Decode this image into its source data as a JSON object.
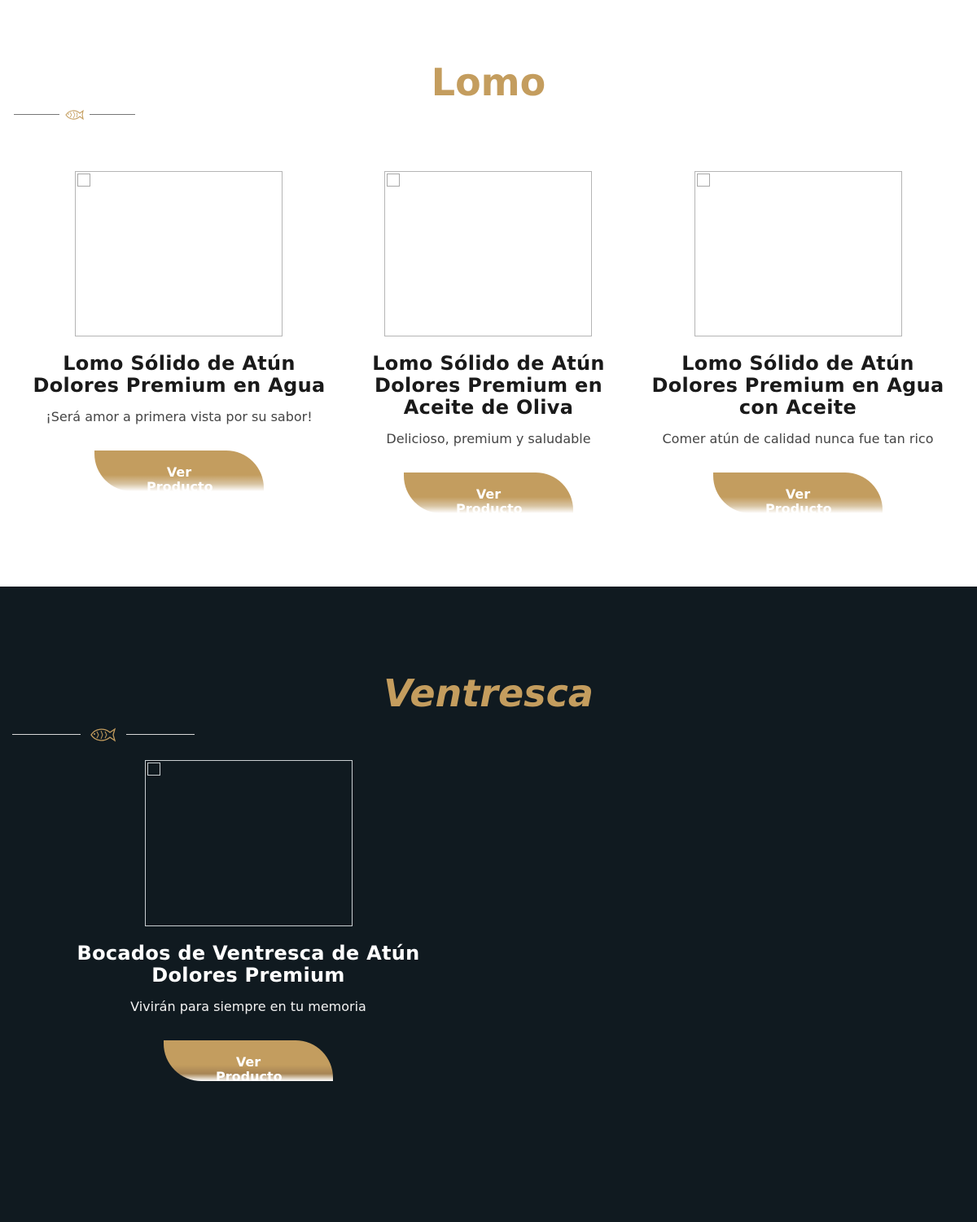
{
  "colors": {
    "accent_gold": "#c49d5e",
    "dark_background": "#101a20",
    "light_background": "#ffffff"
  },
  "lomo": {
    "title": "Lomo",
    "divider_icon": "fish-icon",
    "products": [
      {
        "title": "Lomo Sólido de Atún Dolores Premium en Agua",
        "description": "¡Será amor a primera vista por su sabor!",
        "button_label": "Ver Producto"
      },
      {
        "title": "Lomo Sólido de Atún Dolores Premium en Aceite de Oliva",
        "description": "Delicioso, premium y saludable",
        "button_label": "Ver Producto"
      },
      {
        "title": "Lomo Sólido de Atún Dolores Premium en Agua con Aceite",
        "description": "Comer atún de calidad nunca fue tan rico",
        "button_label": "Ver Producto"
      }
    ]
  },
  "ventresca": {
    "title": "Ventresca",
    "divider_icon": "fish-icon",
    "products": [
      {
        "title": "Bocados de Ventresca de Atún Dolores Premium",
        "description": "Vivirán para siempre en tu memoria",
        "button_label": "Ver Producto"
      }
    ]
  }
}
